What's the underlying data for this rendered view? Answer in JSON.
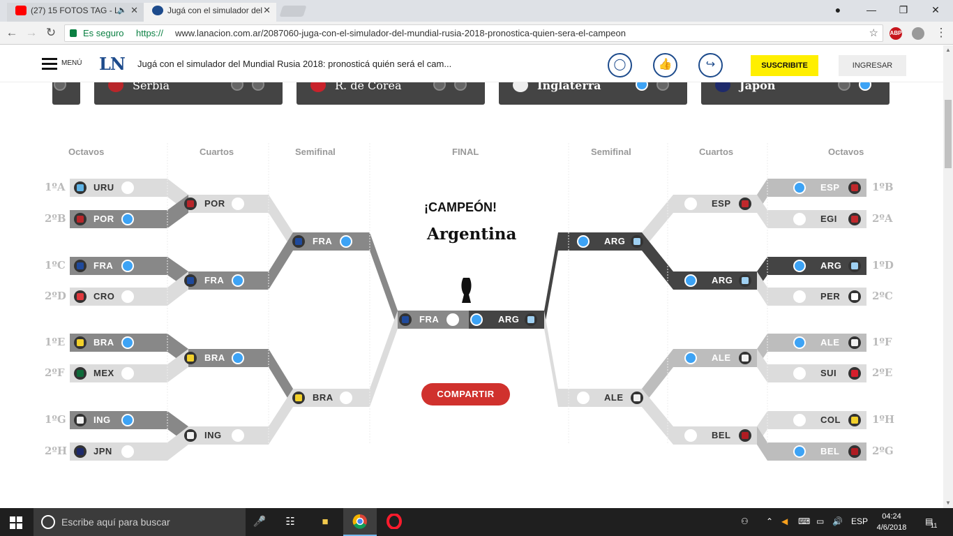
{
  "browser": {
    "tabs": [
      {
        "title": "(27) 15 FOTOS TAG - L",
        "favicon_color": "#ff0000"
      },
      {
        "title": "Jugá con el simulador del",
        "favicon_color": "#1d4b8c"
      }
    ],
    "secure_label": "Es seguro",
    "url_protocol": "https://",
    "url_rest": "www.lanacion.com.ar/2087060-juga-con-el-simulador-del-mundial-rusia-2018-pronostica-quien-sera-el-campeon",
    "ext_abp": "ABP"
  },
  "site": {
    "menu_label": "MENÚ",
    "logo": "LN",
    "headline": "Jugá con el simulador del Mundial Rusia 2018: pronosticá quién será el cam...",
    "subscribe_label": "SUSCRIBITE",
    "login_label": "INGRESAR"
  },
  "group_cards": [
    {
      "name": "Serbia",
      "shirt": "#b8262a"
    },
    {
      "name": "R. de Corea",
      "shirt": "#c8222b"
    },
    {
      "name": "Inglaterra",
      "shirt": "#eee"
    },
    {
      "name": "Japón",
      "shirt": "#1e2a6b"
    }
  ],
  "bracket": {
    "headers": {
      "left_octavos": "Octavos",
      "left_cuartos": "Cuartos",
      "left_semi": "Semifinal",
      "final": "FINAL",
      "right_semi": "Semifinal",
      "right_cuartos": "Cuartos",
      "right_octavos": "Octavos"
    },
    "left_octavos": [
      {
        "seed": "1ºA",
        "team": "URU",
        "picked": false
      },
      {
        "seed": "2ºB",
        "team": "POR",
        "picked": true
      },
      {
        "seed": "1ºC",
        "team": "FRA",
        "picked": true
      },
      {
        "seed": "2ºD",
        "team": "CRO",
        "picked": false
      },
      {
        "seed": "1ºE",
        "team": "BRA",
        "picked": true
      },
      {
        "seed": "2ºF",
        "team": "MEX",
        "picked": false
      },
      {
        "seed": "1ºG",
        "team": "ING",
        "picked": true
      },
      {
        "seed": "2ºH",
        "team": "JPN",
        "picked": false
      }
    ],
    "left_cuartos": [
      {
        "team": "POR",
        "picked": false
      },
      {
        "team": "FRA",
        "picked": true
      },
      {
        "team": "BRA",
        "picked": true
      },
      {
        "team": "ING",
        "picked": false
      }
    ],
    "left_semi": [
      {
        "team": "FRA",
        "picked": true
      },
      {
        "team": "BRA",
        "picked": false
      }
    ],
    "final_left": {
      "team": "FRA",
      "picked": false
    },
    "final_right": {
      "team": "ARG",
      "picked": true
    },
    "right_semi": [
      {
        "team": "ARG",
        "picked": true
      },
      {
        "team": "ALE",
        "picked": false
      }
    ],
    "right_cuartos": [
      {
        "team": "ESP",
        "picked": false
      },
      {
        "team": "ARG",
        "picked": true
      },
      {
        "team": "ALE",
        "picked": true
      },
      {
        "team": "BEL",
        "picked": false
      }
    ],
    "right_octavos": [
      {
        "seed": "1ºB",
        "team": "ESP",
        "picked": true
      },
      {
        "seed": "2ºA",
        "team": "EGI",
        "picked": false
      },
      {
        "seed": "1ºD",
        "team": "ARG",
        "picked": true
      },
      {
        "seed": "2ºC",
        "team": "PER",
        "picked": false
      },
      {
        "seed": "1ºF",
        "team": "ALE",
        "picked": true
      },
      {
        "seed": "2ºE",
        "team": "SUI",
        "picked": false
      },
      {
        "seed": "1ºH",
        "team": "COL",
        "picked": false
      },
      {
        "seed": "2ºG",
        "team": "BEL",
        "picked": true
      }
    ],
    "champion_label": "¡CAMPEÓN!",
    "champion_name": "Argentina",
    "share_label": "COMPARTIR"
  },
  "shirts": {
    "URU": "#5fb4e6",
    "POR": "#b8262a",
    "FRA": "#1f4a9c",
    "CRO": "#e0393e",
    "BRA": "#f2d02a",
    "MEX": "#0e6b3a",
    "ING": "#f2f2f2",
    "JPN": "#1e2a6b",
    "ESP": "#c0282c",
    "EGI": "#c0282c",
    "ARG": "#9fd0f2",
    "PER": "#ffffff",
    "ALE": "#f2f2f2",
    "SUI": "#d61e2c",
    "COL": "#f2d02a",
    "BEL": "#b01c22"
  },
  "colors": {
    "picked": "#3da3f5",
    "dark_path": "#444444",
    "mid_path": "#888888",
    "light_path": "#dcdcdc",
    "share": "#d0312d"
  },
  "taskbar": {
    "search_placeholder": "Escribe aquí para buscar",
    "lang": "ESP",
    "time": "04:24",
    "date": "4/6/2018",
    "notif_count": "11"
  }
}
